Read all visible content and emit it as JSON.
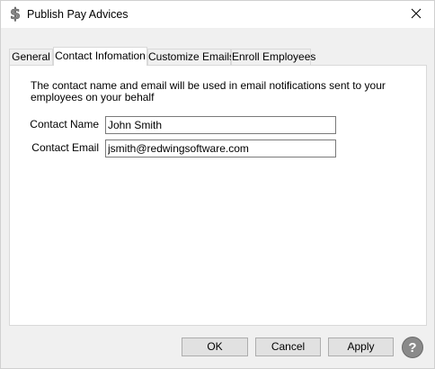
{
  "window": {
    "title": "Publish Pay Advices",
    "app_icon": "dollar-icon",
    "close_icon": "close-icon"
  },
  "tabs": [
    {
      "label": "General",
      "active": false
    },
    {
      "label": "Contact Infomation",
      "active": true
    },
    {
      "label": "Customize Emails",
      "active": false
    },
    {
      "label": "Enroll Employees",
      "active": false
    }
  ],
  "contact": {
    "description": "The contact name and email will be used in email notifications sent to your employees on your behalf",
    "name_label": "Contact Name",
    "name_value": "John Smith",
    "email_label": "Contact Email",
    "email_value": "jsmith@redwingsoftware.com"
  },
  "buttons": {
    "ok": "OK",
    "cancel": "Cancel",
    "apply": "Apply",
    "help_icon": "help-icon",
    "help_glyph": "?"
  }
}
